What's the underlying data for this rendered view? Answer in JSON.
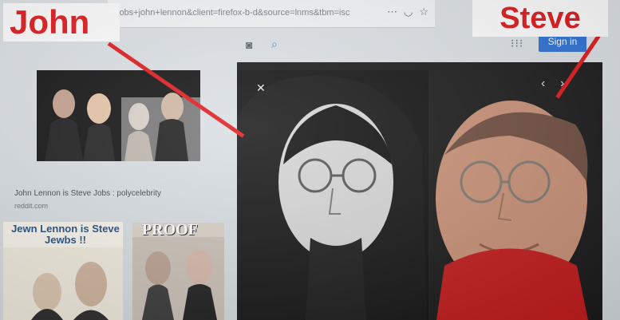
{
  "labels": {
    "john": "John",
    "steve": "Steve"
  },
  "browser": {
    "url_text": "jobs+john+lennon&client=firefox-b-d&source=lnms&tbm=isc",
    "sign_in_label": "Sign in"
  },
  "results": {
    "caption": "John Lennon is Steve Jobs : polycelebrity",
    "source": "reddit.com",
    "tile2_title": "Jewn Lennon is Steve Jewbs !!",
    "tile3_title": "PROOF"
  },
  "icons": {
    "more": "ellipsis-icon",
    "pocket": "pocket-icon",
    "bookmark": "star-icon",
    "camera": "camera-icon",
    "search": "search-icon",
    "apps": "apps-grid-icon",
    "close": "close-icon",
    "prev": "chevron-left-icon",
    "next": "chevron-right-icon"
  },
  "colors": {
    "annotation_red": "#e0191c",
    "signin_blue": "#2f73d6"
  }
}
